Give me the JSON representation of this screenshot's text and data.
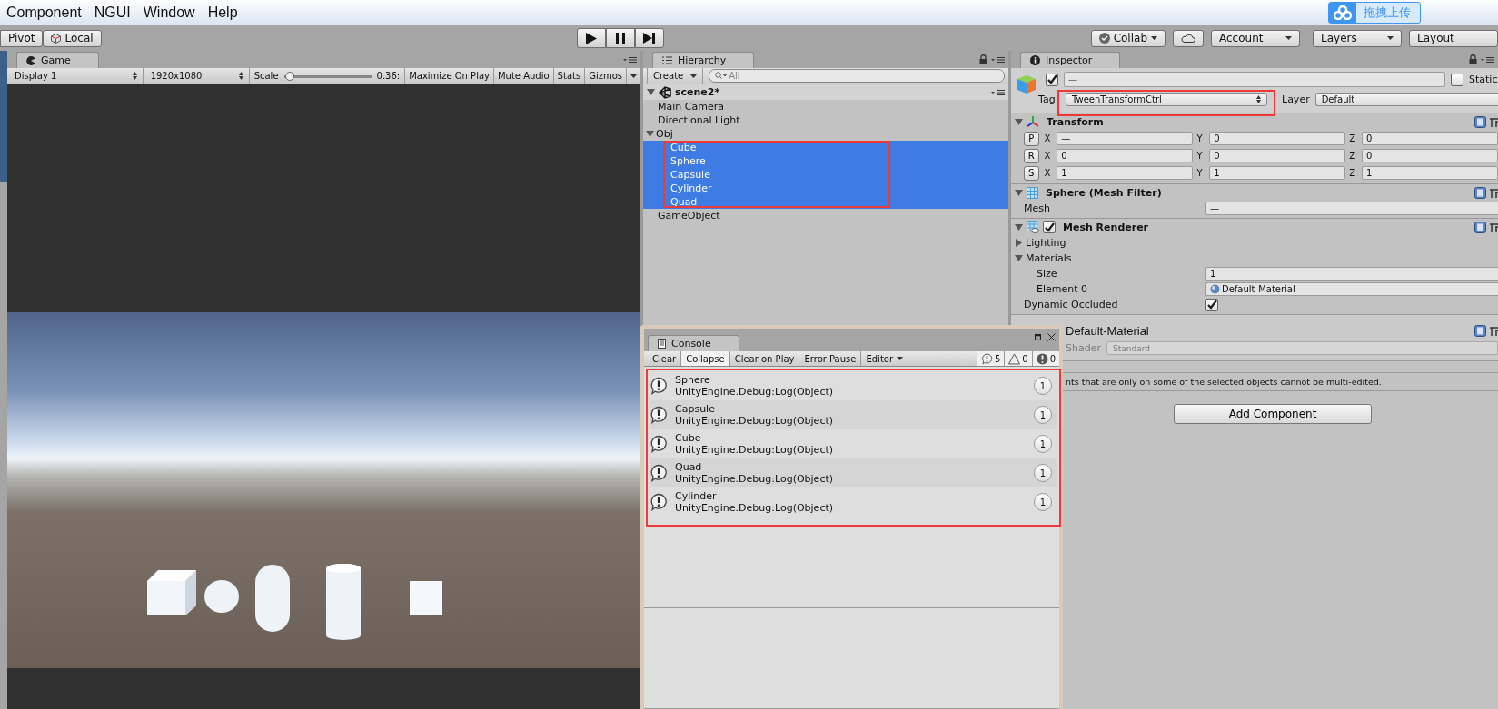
{
  "menu_bar": {
    "items": [
      "Component",
      "NGUI",
      "Window",
      "Help"
    ]
  },
  "upload_widget": {
    "label": "拖拽上传"
  },
  "toolbar": {
    "pivot": "Pivot",
    "space": "Local",
    "collab": "Collab",
    "account": "Account",
    "layers": "Layers",
    "layout": "Layout"
  },
  "game": {
    "tab": "Game",
    "display": "Display 1",
    "resolution": "1920x1080",
    "scale_label": "Scale",
    "scale": {
      "level": 0.02
    },
    "scale_reading": "0.36:",
    "toggles": [
      {
        "label": "Maximize On Play",
        "on": false
      },
      {
        "label": "Mute Audio",
        "on": false
      },
      {
        "label": "Stats",
        "on": false
      },
      {
        "label": "Gizmos",
        "on": false
      }
    ]
  },
  "hierarchy": {
    "tab": "Hierarchy",
    "create": "Create",
    "search_placeholder": "All",
    "scene": {
      "name": "scene2*",
      "expanded": true,
      "children": [
        {
          "name": "Main Camera",
          "selected": false
        },
        {
          "name": "Directional Light",
          "selected": false
        },
        {
          "name": "Obj",
          "selected": false,
          "expanded": true,
          "children": [
            {
              "name": "Cube",
              "selected": true
            },
            {
              "name": "Sphere",
              "selected": true
            },
            {
              "name": "Capsule",
              "selected": true
            },
            {
              "name": "Cylinder",
              "selected": true
            },
            {
              "name": "Quad",
              "selected": true
            }
          ]
        },
        {
          "name": "GameObject",
          "selected": false
        }
      ]
    }
  },
  "inspector": {
    "tab": "Inspector",
    "active": true,
    "name_value": "—",
    "static_label": "Static",
    "static": false,
    "tag_label": "Tag",
    "tag": "TweenTransformCtrl",
    "layer_label": "Layer",
    "layer": "Default",
    "transform": {
      "title": "Transform",
      "expanded": true,
      "rows": [
        {
          "button": "P",
          "fields": [
            {
              "axis": "X",
              "value": "—"
            },
            {
              "axis": "Y",
              "value": "0"
            },
            {
              "axis": "Z",
              "value": "0"
            }
          ]
        },
        {
          "button": "R",
          "fields": [
            {
              "axis": "X",
              "value": "0"
            },
            {
              "axis": "Y",
              "value": "0"
            },
            {
              "axis": "Z",
              "value": "0"
            }
          ]
        },
        {
          "button": "S",
          "fields": [
            {
              "axis": "X",
              "value": "1"
            },
            {
              "axis": "Y",
              "value": "1"
            },
            {
              "axis": "Z",
              "value": "1"
            }
          ]
        }
      ]
    },
    "mesh_filter": {
      "title": "Sphere (Mesh Filter)",
      "expanded": true,
      "mesh_label": "Mesh",
      "mesh": "—"
    },
    "mesh_renderer": {
      "title": "Mesh Renderer",
      "expanded": true,
      "enabled": true,
      "lighting": {
        "label": "Lighting",
        "expanded": false
      },
      "materials": {
        "label": "Materials",
        "expanded": true,
        "size_label": "Size",
        "size": "1",
        "element_label": "Element 0",
        "element": "Default-Material"
      },
      "occluded_label": "Dynamic Occluded",
      "occluded": true
    },
    "material": {
      "name": "Default-Material",
      "shader_label": "Shader",
      "shader": "Standard",
      "disabled": true
    },
    "warning": "nts that are only on some of the selected objects cannot be multi-edited.",
    "add_component": "Add Component"
  },
  "console": {
    "tab": "Console",
    "buttons": [
      {
        "label": "Clear",
        "on": false
      },
      {
        "label": "Collapse",
        "on": true
      },
      {
        "label": "Clear on Play",
        "on": false
      },
      {
        "label": "Error Pause",
        "on": false
      }
    ],
    "editor": "Editor",
    "counts": [
      {
        "kind": "info",
        "count": "5"
      },
      {
        "kind": "warning",
        "count": "0"
      },
      {
        "kind": "error",
        "count": "0"
      }
    ],
    "entries": [
      {
        "message": "Sphere",
        "trace": "UnityEngine.Debug:Log(Object)",
        "count": "1"
      },
      {
        "message": "Capsule",
        "trace": "UnityEngine.Debug:Log(Object)",
        "count": "1"
      },
      {
        "message": "Cube",
        "trace": "UnityEngine.Debug:Log(Object)",
        "count": "1"
      },
      {
        "message": "Quad",
        "trace": "UnityEngine.Debug:Log(Object)",
        "count": "1"
      },
      {
        "message": "Cylinder",
        "trace": "UnityEngine.Debug:Log(Object)",
        "count": "1"
      }
    ]
  }
}
